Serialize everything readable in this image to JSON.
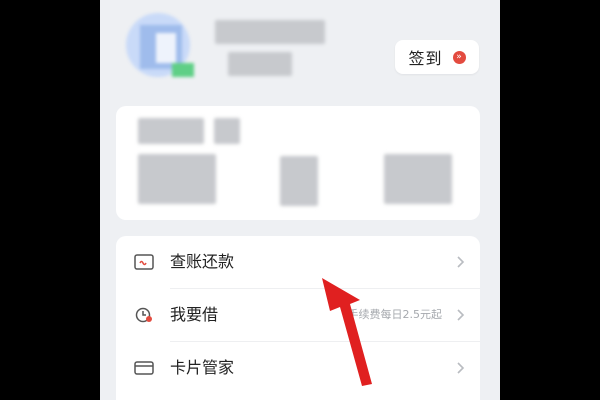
{
  "profile": {
    "signin_label": "签到",
    "signin_badge": "»"
  },
  "menu": {
    "items": [
      {
        "label": "查账还款",
        "subtitle": "",
        "icon": "bill-card-icon"
      },
      {
        "label": "我要借",
        "subtitle": "手续费每日2.5元起",
        "icon": "loan-clock-icon"
      },
      {
        "label": "卡片管家",
        "subtitle": "",
        "icon": "card-icon"
      }
    ]
  },
  "colors": {
    "accent_red": "#e34b3f",
    "arrow_red": "#e02020",
    "background": "#eef0f3"
  }
}
